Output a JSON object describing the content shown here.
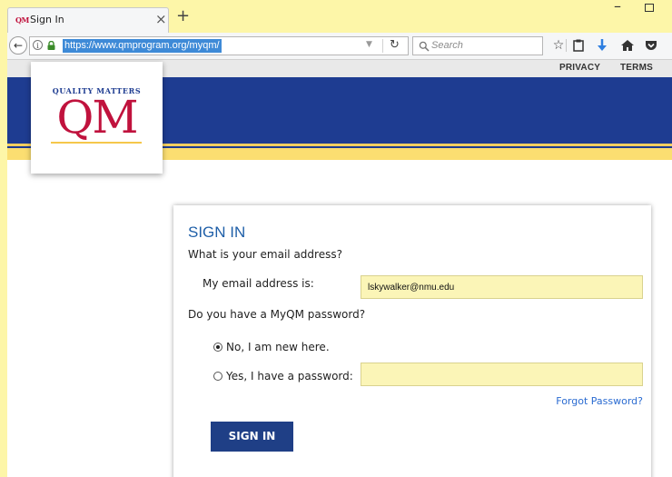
{
  "browser": {
    "tab": {
      "favicon_text": "QM",
      "title": "Sign In",
      "close_glyph": "×"
    },
    "new_tab_glyph": "+",
    "url": "https://www.qmprogram.org/myqm/",
    "search_placeholder": "Search",
    "icons": [
      "back-arrow-icon",
      "info-icon",
      "lock-icon",
      "dropdown-icon",
      "reload-icon",
      "search-icon",
      "bookmark-star-icon",
      "clipboard-icon",
      "download-icon",
      "home-icon",
      "pocket-icon"
    ]
  },
  "utility_nav": {
    "privacy": "PRIVACY",
    "terms": "TERMS"
  },
  "logo": {
    "tagline": "QUALITY MATTERS",
    "mark": "QM"
  },
  "signin": {
    "title": "SIGN IN",
    "email_question": "What is your email address?",
    "email_label": "My email address is:",
    "email_value": "lskywalker@nmu.edu",
    "password_question": "Do you have a MyQM password?",
    "option_new": "No, I am new here.",
    "option_existing": "Yes, I have a password:",
    "password_value": "",
    "forgot_link": "Forgot Password?",
    "button": "SIGN IN"
  },
  "colors": {
    "brand_blue": "#1e3c91",
    "brand_red": "#c0123d",
    "gold": "#fbde71",
    "field_fill": "#fbf5b7",
    "link_blue": "#2a6bd1"
  }
}
